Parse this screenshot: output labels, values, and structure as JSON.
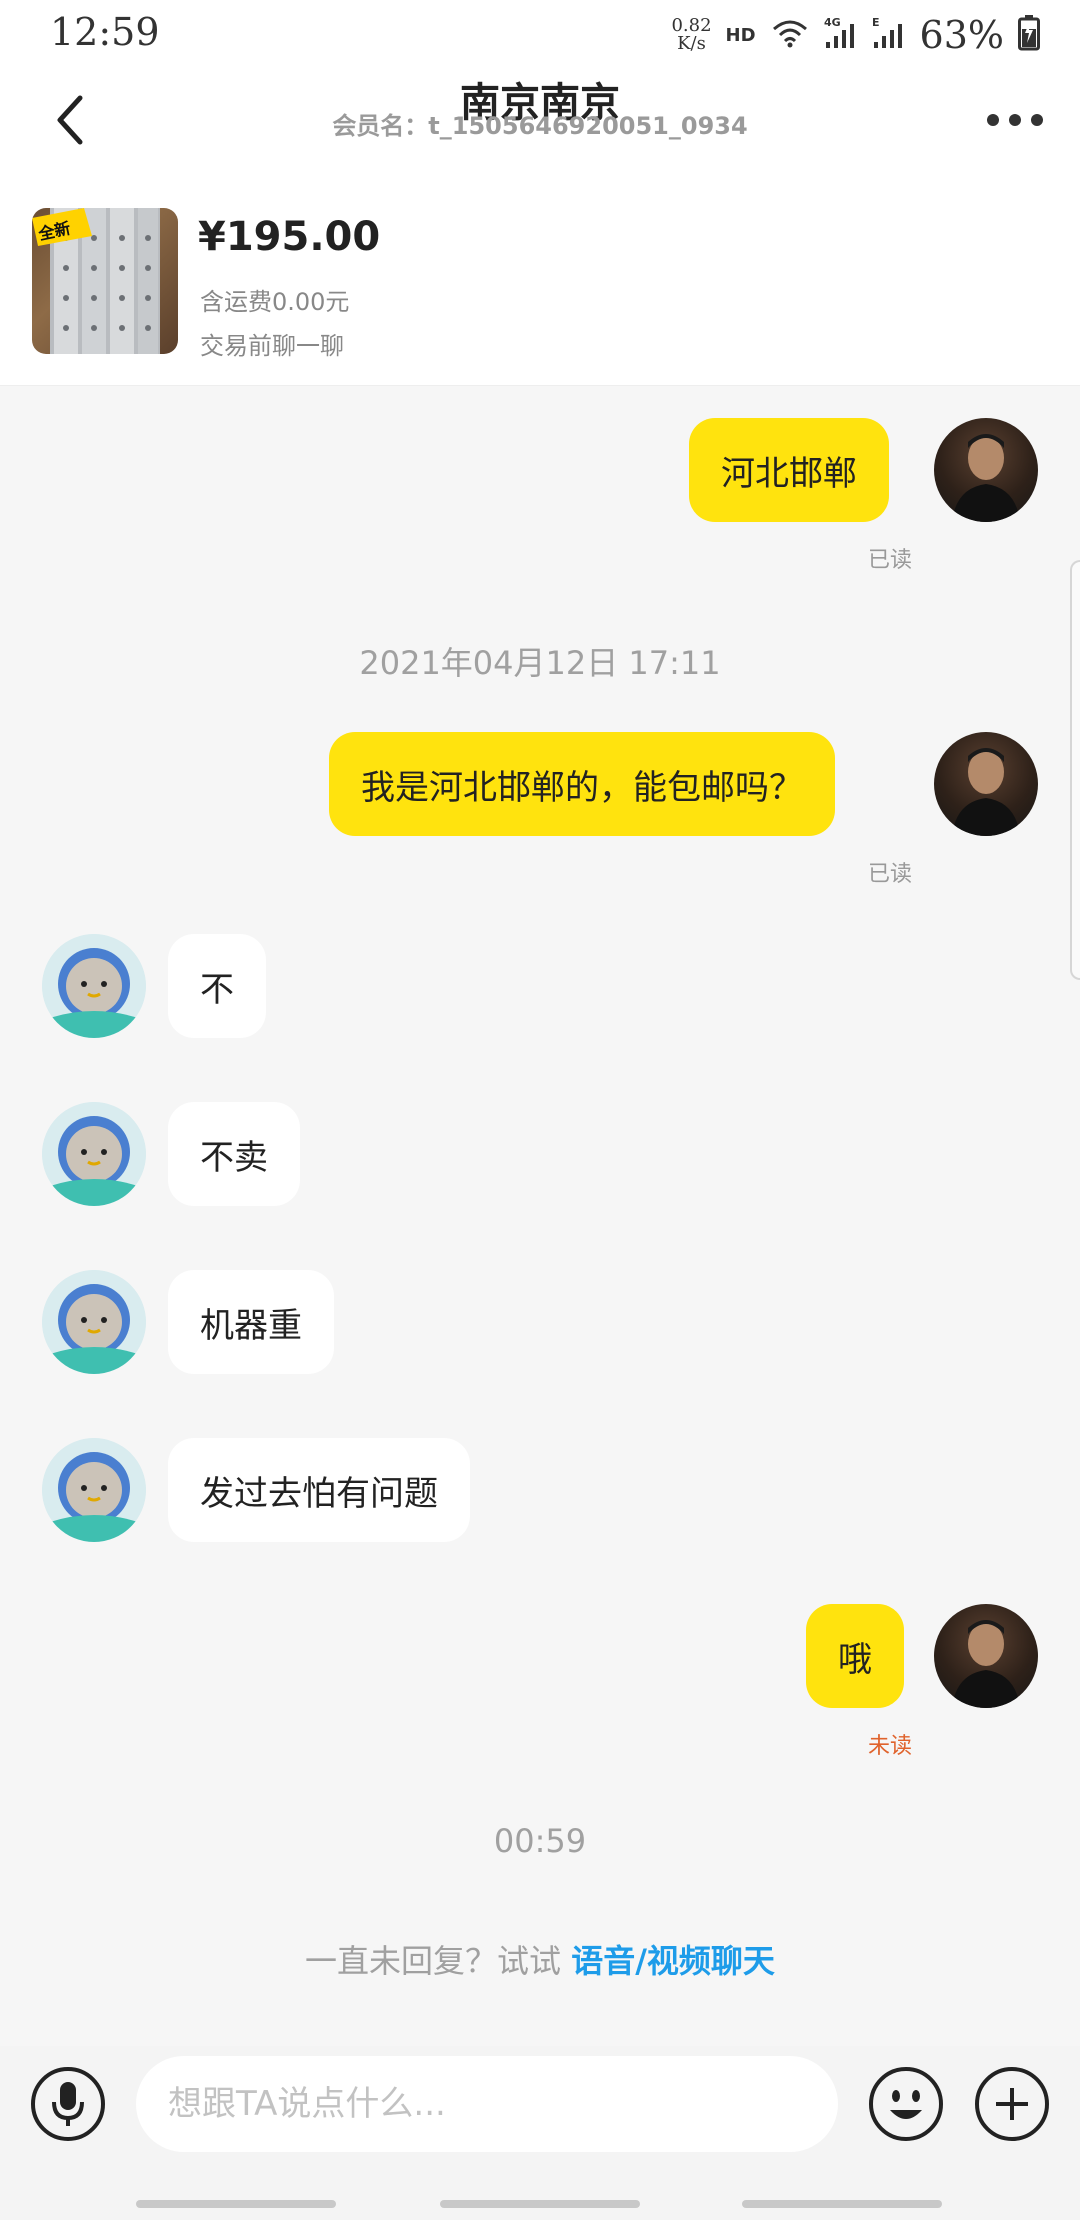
{
  "status_bar": {
    "time": "12:59",
    "net_speed_value": "0.82",
    "net_speed_unit": "K/s",
    "hd": "HD",
    "battery": "63%",
    "icons": [
      "wifi-icon",
      "4g-signal-icon",
      "e-signal-icon",
      "battery-icon"
    ]
  },
  "header": {
    "title": "南京南京",
    "subtitle": "会员名：t_1505646920051_0934",
    "back_icon": "chevron-left-icon",
    "more_icon": "more-dots-icon"
  },
  "product": {
    "image_badge": "全新",
    "price": "¥195.00",
    "shipping": "含运费0.00元",
    "note": "交易前聊一聊"
  },
  "messages": [
    {
      "from": "me",
      "text": "河北邯郸",
      "status": "已读"
    },
    {
      "type": "timestamp",
      "text": "2021年04月12日 17:11"
    },
    {
      "from": "me",
      "text": "我是河北邯郸的，能包邮吗？",
      "status": "已读"
    },
    {
      "from": "seller",
      "text": "不"
    },
    {
      "from": "seller",
      "text": "不卖"
    },
    {
      "from": "seller",
      "text": "机器重"
    },
    {
      "from": "seller",
      "text": "发过去怕有问题"
    },
    {
      "from": "me",
      "text": "哦",
      "status": "未读"
    },
    {
      "type": "timestamp",
      "text": "00:59"
    }
  ],
  "call_hint": {
    "prefix": "一直未回复？试试",
    "link": "语音/视频聊天"
  },
  "input_bar": {
    "placeholder": "想跟TA说点什么...",
    "voice_icon": "microphone-icon",
    "emoji_icon": "smiley-icon",
    "plus_icon": "plus-icon"
  },
  "colors": {
    "outgoing_bubble": "#ffe30e",
    "incoming_bubble": "#ffffff",
    "unread": "#e0632c",
    "link": "#1e9ce9",
    "background": "#f6f6f6"
  }
}
